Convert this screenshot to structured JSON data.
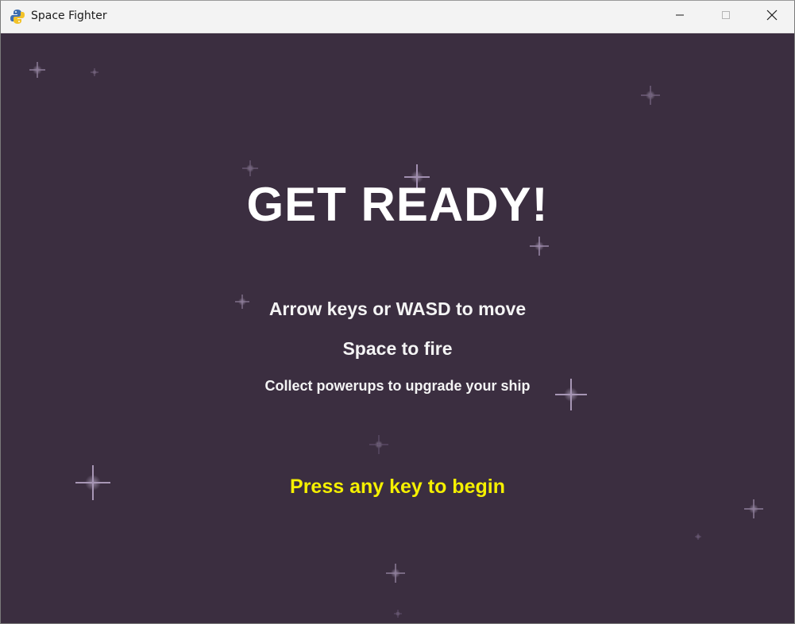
{
  "window": {
    "title": "Space Fighter",
    "app_icon": "pygame-snake-icon",
    "controls": {
      "minimize_icon": "minimize-icon",
      "maximize_icon": "maximize-icon",
      "close_icon": "close-icon"
    }
  },
  "game": {
    "background_color": "#3b2e40",
    "headline": "GET READY!",
    "instructions": [
      "Arrow keys or WASD to move",
      "Space to fire",
      "Collect powerups to upgrade your ship"
    ],
    "prompt": "Press any key to begin",
    "prompt_color": "#f5f000"
  }
}
